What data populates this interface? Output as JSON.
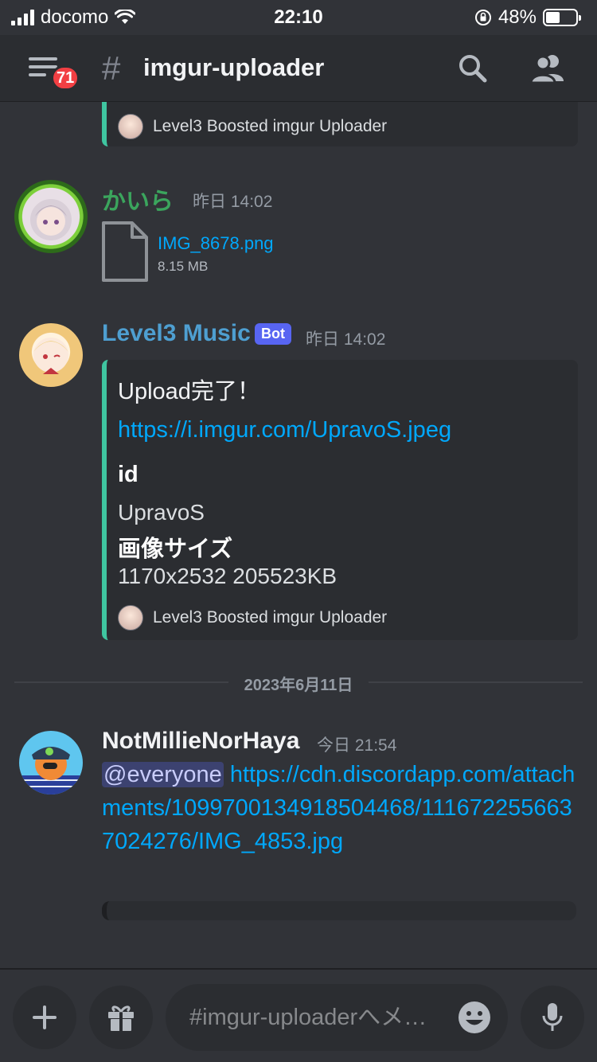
{
  "status_bar": {
    "carrier": "docomo",
    "time": "22:10",
    "battery_percent": "48%",
    "battery_level": 0.48
  },
  "header": {
    "unread_badge": "71",
    "channel_hash": "#",
    "channel_name": "imgur-uploader"
  },
  "messages": {
    "top_embed_footer": "Level3 Boosted imgur Uploader",
    "kaira": {
      "username": "かいら",
      "username_color": "#3ba55d",
      "timestamp": "昨日 14:02",
      "file_name": "IMG_8678.png",
      "file_size": "8.15 MB"
    },
    "level3": {
      "username": "Level3 Music",
      "username_color": "#4e9fd1",
      "bot_tag": "Bot",
      "timestamp": "昨日 14:02",
      "embed": {
        "description": "Upload完了！",
        "link": "https://i.imgur.com/UpravoS.jpeg",
        "field1_name": "id",
        "field1_value": "UpravoS",
        "field2_name": "画像サイズ",
        "field2_value": "1170x2532 205523KB",
        "footer": "Level3 Boosted imgur Uploader"
      }
    },
    "date_divider": "2023年6月11日",
    "notmillie": {
      "username": "NotMillieNorHaya",
      "timestamp": "今日 21:54",
      "mention": "@everyone",
      "link": "https://cdn.discordapp.com/attachments/1099700134918504468/1116722556637024276/IMG_4853.jpg"
    }
  },
  "composer": {
    "placeholder": "#imgur-uploaderへメ…"
  },
  "icons": {
    "menu": "hamburger-icon",
    "search": "search-icon",
    "members": "members-icon",
    "add": "plus-icon",
    "gift": "gift-icon",
    "emoji": "emoji-icon",
    "mic": "microphone-icon"
  }
}
